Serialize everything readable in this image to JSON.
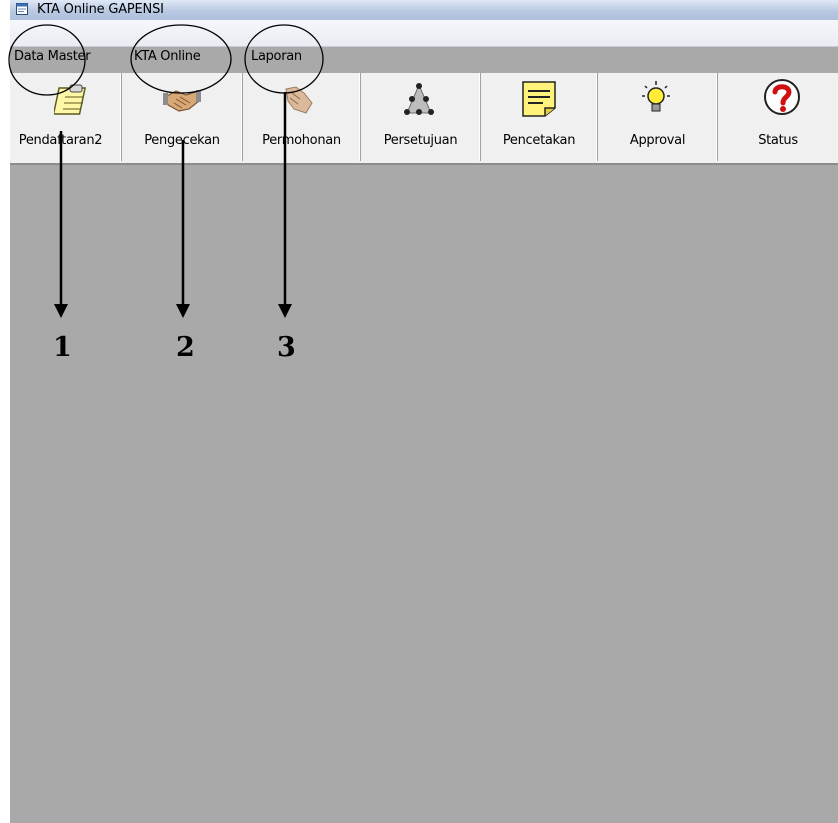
{
  "window": {
    "title": "KTA Online GAPENSI",
    "icon": "app-window-icon"
  },
  "menu": {
    "items": [
      "Data Master",
      "KTA Online",
      "Laporan"
    ]
  },
  "toolbar": {
    "buttons": [
      {
        "label": "Pendaftaran2",
        "icon": "register-notepad-icon"
      },
      {
        "label": "Pengecekan",
        "icon": "handshake-icon"
      },
      {
        "label": "Permohonan",
        "icon": "request-hand-icon"
      },
      {
        "label": "Persetujuan",
        "icon": "approval-network-icon"
      },
      {
        "label": "Pencetakan",
        "icon": "printing-note-icon"
      },
      {
        "label": "Approval",
        "icon": "lightbulb-icon"
      },
      {
        "label": "Status",
        "icon": "question-icon"
      }
    ]
  },
  "annotations": {
    "numbers": [
      "1",
      "2",
      "3"
    ]
  },
  "colors": {
    "workspace": "#a9a9a9",
    "toolbar": "#f0f0f0",
    "titlebar": "#b9c9e2"
  }
}
